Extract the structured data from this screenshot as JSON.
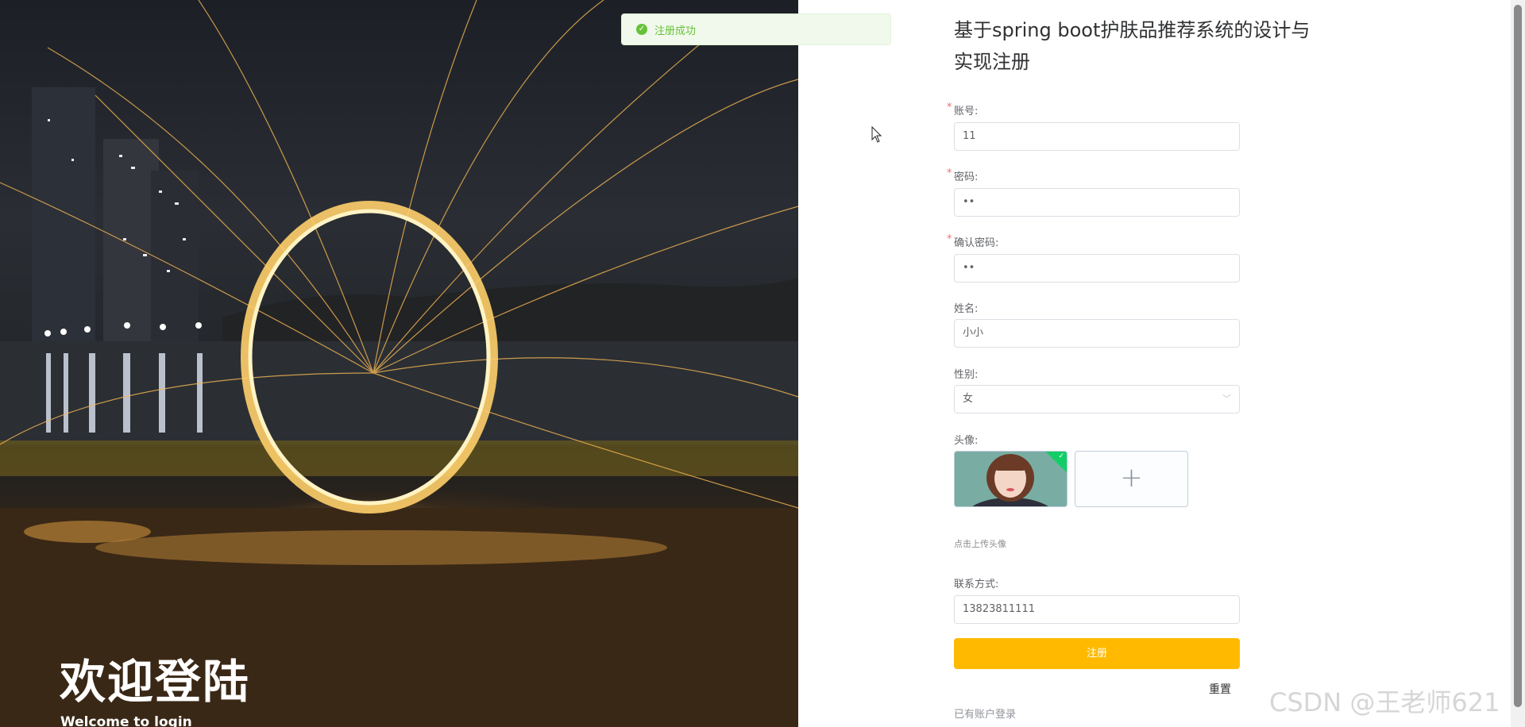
{
  "hero": {
    "title": "欢迎登陆",
    "subtitle": "Welcome to login"
  },
  "toast": {
    "text": "注册成功",
    "icon": "check-circle-icon",
    "color": "#67c23a"
  },
  "form": {
    "title": "基于spring boot护肤品推荐系统的设计与实现注册",
    "fields": {
      "account": {
        "label": "账号:",
        "value": "11",
        "required": true
      },
      "password": {
        "label": "密码:",
        "value": "••",
        "required": true
      },
      "confirm_password": {
        "label": "确认密码:",
        "value": "••",
        "required": true
      },
      "name": {
        "label": "姓名:",
        "value": "小小"
      },
      "gender": {
        "label": "性别:",
        "value": "女"
      },
      "avatar": {
        "label": "头像:",
        "hint": "点击上传头像"
      },
      "contact": {
        "label": "联系方式:",
        "value": "13823811111"
      }
    },
    "required_mark": "*",
    "upload_plus": "+",
    "submit_label": "注册",
    "reset_label": "重置",
    "login_link": "已有账户登录",
    "accent_color": "#ffba00"
  },
  "watermark": "CSDN @王老师621"
}
